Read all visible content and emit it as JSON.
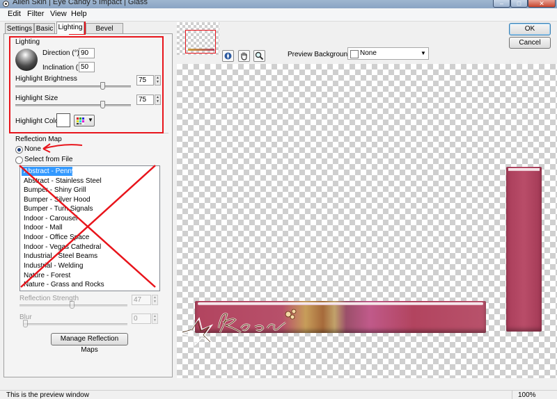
{
  "window": {
    "title": "Alien Skin | Eye Candy 5 Impact | Glass",
    "close": "✕"
  },
  "menu": [
    "Edit",
    "Filter",
    "View",
    "Help"
  ],
  "tabs": [
    "Settings",
    "Basic",
    "Lighting",
    "Bevel Profile"
  ],
  "lighting": {
    "group_label": "Lighting",
    "direction_label": "Direction (°)",
    "direction_value": "90",
    "inclination_label": "Inclination (°)",
    "inclination_value": "50",
    "highlight_brightness_label": "Highlight Brightness",
    "highlight_brightness_value": "75",
    "highlight_size_label": "Highlight Size",
    "highlight_size_value": "75",
    "highlight_color_label": "Highlight Color"
  },
  "reflection": {
    "group_label": "Reflection Map",
    "none_label": "None",
    "select_file_label": "Select from File",
    "maps": [
      "Abstract - Penny",
      "Abstract - Stainless Steel",
      "Bumper - Shiny Grill",
      "Bumper - Silver Hood",
      "Bumper - Turn Signals",
      "Indoor - Carousel",
      "Indoor - Mall",
      "Indoor - Office Space",
      "Indoor - Vegas Cathedral",
      "Industrial - Steel Beams",
      "Industrial - Welding",
      "Nature - Forest",
      "Nature - Grass and Rocks"
    ],
    "strength_label": "Reflection Strength",
    "strength_value": "47",
    "blur_label": "Blur",
    "blur_value": "0",
    "manage_button": "Manage Reflection Maps"
  },
  "preview_background": {
    "label": "Preview Background:",
    "value": "None"
  },
  "buttons": {
    "ok": "OK",
    "cancel": "Cancel"
  },
  "status": {
    "text": "This is the preview window",
    "zoom": "100%"
  },
  "colors": {
    "annotation_red": "#e8141b",
    "bar_fill": "#b2445f",
    "highlight_swatch": "#ffffff"
  },
  "icons": [
    "sphere-light-icon",
    "color-grid-icon",
    "zoom-navigator-icon",
    "hand-pan-icon",
    "magnifier-icon",
    "dropdown-arrow-icon"
  ]
}
